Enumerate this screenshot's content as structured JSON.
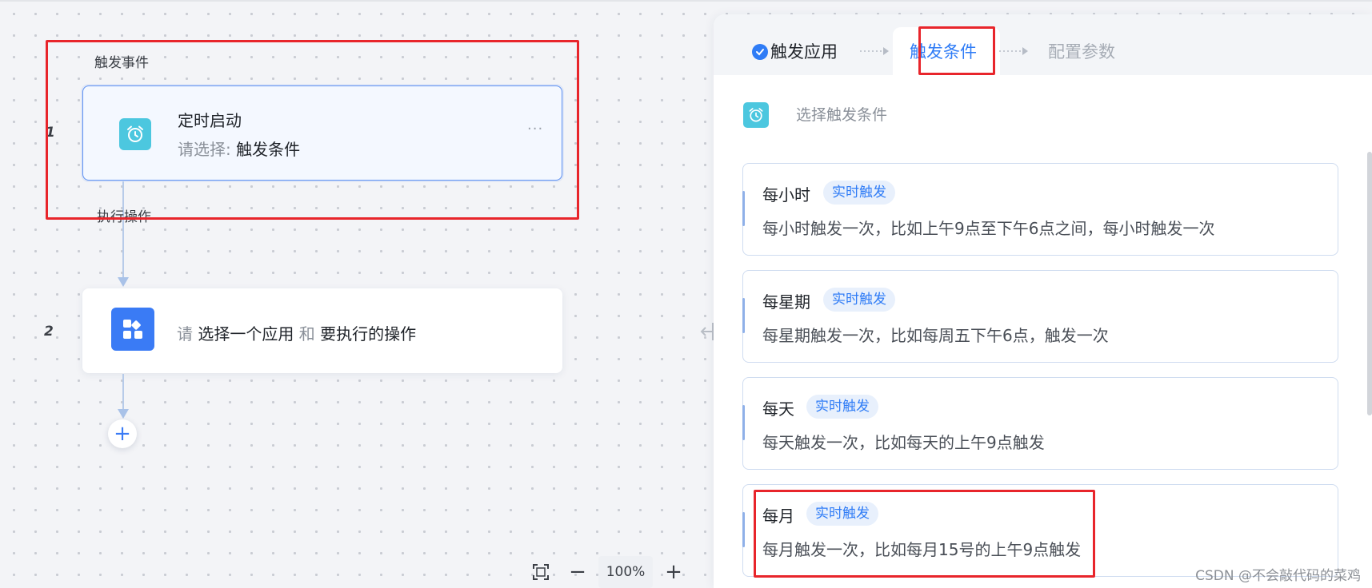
{
  "flow": {
    "trigger_section_label": "触发事件",
    "action_section_label": "执行操作",
    "nodes": [
      {
        "number": "1",
        "title": "定时启动",
        "sub_prefix": "请选择:",
        "sub_value": "触发条件",
        "icon": "alarm-clock-icon",
        "more": "···"
      },
      {
        "number": "2",
        "t1": "请",
        "t2": "选择一个应用",
        "t3": "和",
        "t4": "要执行的操作",
        "icon": "apps-grid-icon"
      }
    ],
    "add_label": "+"
  },
  "zoom": {
    "value": "100%",
    "minus": "−",
    "plus": "+"
  },
  "panel": {
    "steps": [
      {
        "label": "触发应用",
        "state": "done"
      },
      {
        "label": "触发条件",
        "state": "active"
      },
      {
        "label": "配置参数",
        "state": "pending"
      }
    ],
    "section_title": "选择触发条件",
    "conditions": [
      {
        "title": "每小时",
        "badge": "实时触发",
        "desc": "每小时触发一次，比如上午9点至下午6点之间，每小时触发一次"
      },
      {
        "title": "每星期",
        "badge": "实时触发",
        "desc": "每星期触发一次，比如每周五下午6点，触发一次"
      },
      {
        "title": "每天",
        "badge": "实时触发",
        "desc": "每天触发一次，比如每天的上午9点触发"
      },
      {
        "title": "每月",
        "badge": "实时触发",
        "desc": "每月触发一次，比如每月15号的上午9点触发"
      }
    ]
  },
  "watermark": "CSDN @不会敲代码的菜鸡",
  "colors": {
    "accent": "#2f7cf6",
    "highlight": "#e8252b",
    "timer_icon_bg": "#4cc7df",
    "app_icon_bg": "#3a7bf5"
  }
}
